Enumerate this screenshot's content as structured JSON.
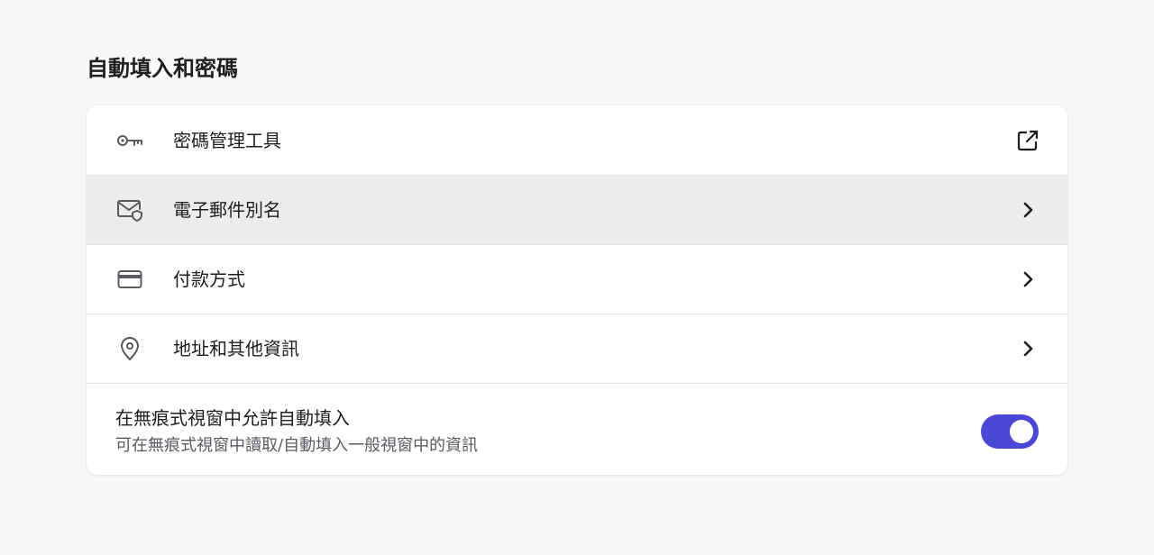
{
  "section": {
    "title": "自動填入和密碼"
  },
  "rows": [
    {
      "label": "密碼管理工具",
      "icon": "key-icon",
      "trailing_icon": "external-link-icon"
    },
    {
      "label": "電子郵件別名",
      "icon": "mail-shield-icon",
      "trailing_icon": "chevron-right-icon",
      "highlighted": true
    },
    {
      "label": "付款方式",
      "icon": "credit-card-icon",
      "trailing_icon": "chevron-right-icon"
    },
    {
      "label": "地址和其他資訊",
      "icon": "location-pin-icon",
      "trailing_icon": "chevron-right-icon"
    }
  ],
  "incognito_autofill": {
    "title": "在無痕式視窗中允許自動填入",
    "description": "可在無痕式視窗中讀取/自動填入一般視窗中的資訊",
    "enabled": true
  },
  "colors": {
    "background": "#f8f8fb",
    "card": "#ffffff",
    "highlight_row": "#ececec",
    "toggle_on": "#4a46d8",
    "text_primary": "#1e1e21",
    "text_secondary": "#5a5a60"
  }
}
